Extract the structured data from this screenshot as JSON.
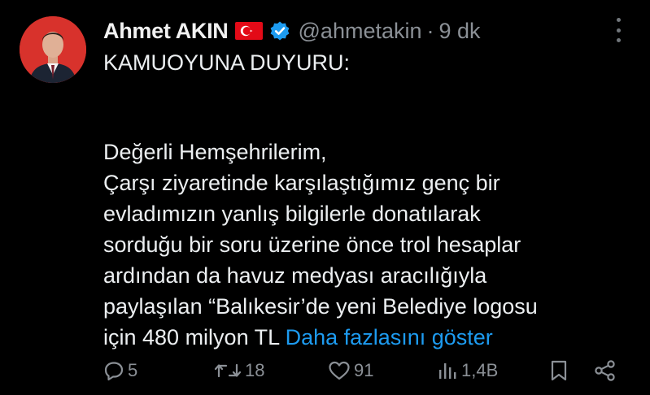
{
  "author": {
    "display_name": "Ahmet AKIN",
    "handle": "@ahmetakin",
    "separator": "·",
    "time": "9 dk",
    "flag_icon": "turkey-flag-icon",
    "verified_icon": "verified-badge-icon"
  },
  "post": {
    "heading": "KAMUOYUNA DUYURU:",
    "lines": [
      "Değerli Hemşehrilerim,",
      "Çarşı ziyaretinde karşılaştığımız genç bir",
      "evladımızın yanlış bilgilerle donatılarak",
      "sorduğu bir soru üzerine önce trol hesaplar",
      "ardından da havuz medyası aracılığıyla",
      "paylaşılan “Balıkesir’de yeni Belediye logosu",
      "için 480 milyon TL"
    ],
    "show_more": "Daha fazlasını göster"
  },
  "actions": {
    "replies": "5",
    "reposts": "18",
    "likes": "91",
    "views": "1,4B"
  },
  "colors": {
    "background": "#000000",
    "text": "#e7e9ea",
    "muted": "#71767b",
    "link": "#1d9bf0",
    "verified": "#1d9bf0",
    "flag_red": "#e30a17"
  }
}
